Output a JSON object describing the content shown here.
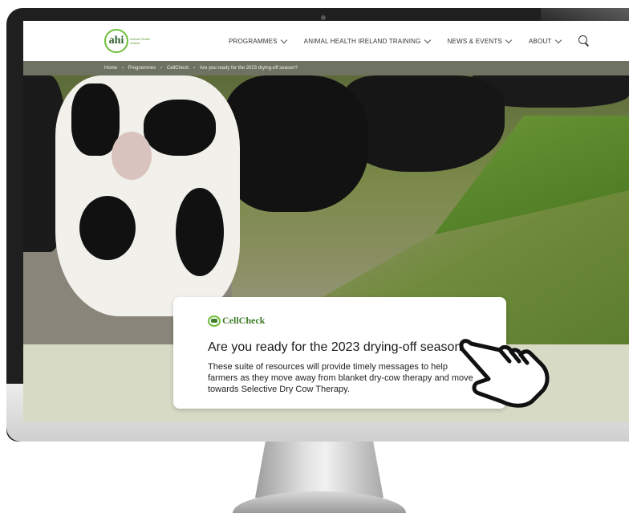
{
  "header": {
    "logo_text": "ahi",
    "logo_tagline": "Animal Health Ireland",
    "nav": [
      {
        "label": "PROGRAMMES",
        "has_dropdown": true
      },
      {
        "label": "ANIMAL HEALTH IRELAND TRAINING",
        "has_dropdown": true
      },
      {
        "label": "NEWS & EVENTS",
        "has_dropdown": true
      },
      {
        "label": "ABOUT",
        "has_dropdown": true
      }
    ],
    "search_icon": "search-icon"
  },
  "breadcrumb": [
    "Home",
    "Programmes",
    "CellCheck",
    "Are you ready for the 2023 drying-off season?"
  ],
  "card": {
    "brand": "CellCheck",
    "title": "Are you ready for the 2023 drying-off season?",
    "description": "These suite of resources will provide timely messages to help farmers as they move away from blanket dry-cow therapy and move towards Selective Dry Cow Therapy."
  },
  "colors": {
    "breadcrumb_bg": "#6e7361",
    "brand_green": "#3e7b2a",
    "band_bg": "#d7dbc6"
  },
  "icons": {
    "pointer": "hand-pointer-icon",
    "breadcrumb_separator": "bullet"
  }
}
